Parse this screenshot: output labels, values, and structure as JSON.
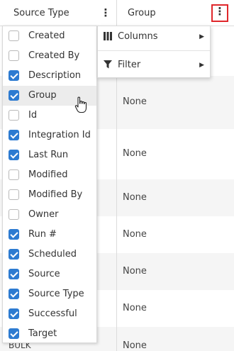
{
  "header": {
    "col1_label": "Source Type",
    "col2_label": "Group"
  },
  "rows": [
    {
      "group": "None"
    },
    {
      "group": "None"
    },
    {
      "group": "None"
    },
    {
      "group": "None"
    },
    {
      "group": "None"
    },
    {
      "group": "None"
    },
    {
      "group": "None"
    }
  ],
  "last_row_source_type": "BULK",
  "column_menu": {
    "columns_label": "Columns",
    "filter_label": "Filter"
  },
  "columns": [
    {
      "label": "Created",
      "checked": false
    },
    {
      "label": "Created By",
      "checked": false
    },
    {
      "label": "Description",
      "checked": true
    },
    {
      "label": "Group",
      "checked": true
    },
    {
      "label": "Id",
      "checked": false
    },
    {
      "label": "Integration Id",
      "checked": true
    },
    {
      "label": "Last Run",
      "checked": true
    },
    {
      "label": "Modified",
      "checked": false
    },
    {
      "label": "Modified By",
      "checked": false
    },
    {
      "label": "Owner",
      "checked": false
    },
    {
      "label": "Run #",
      "checked": true
    },
    {
      "label": "Scheduled",
      "checked": true
    },
    {
      "label": "Source",
      "checked": true
    },
    {
      "label": "Source Type",
      "checked": true
    },
    {
      "label": "Successful",
      "checked": true
    },
    {
      "label": "Target",
      "checked": true
    }
  ],
  "colors": {
    "accent": "#2d7bd1",
    "highlight_border": "#e0272b"
  },
  "icons": {
    "columns": "columns-icon",
    "filter": "filter-icon",
    "menu": "kebab-menu-icon"
  }
}
